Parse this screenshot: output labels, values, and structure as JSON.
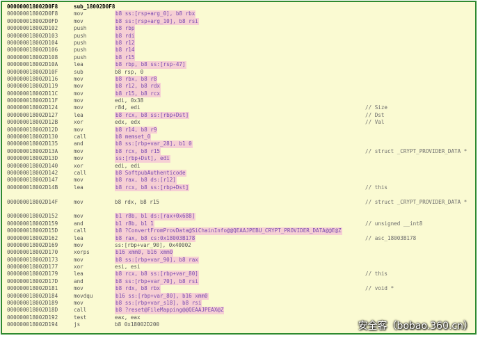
{
  "header": {
    "addr": "000000018002D0F8",
    "name": "sub_18002D0F8"
  },
  "rows": [
    {
      "addr": "000000018002D0F8",
      "mn": "mov",
      "ops": "b8 ss:[rsp+arg_0], b8 rbx",
      "cm": ""
    },
    {
      "addr": "000000018002D0FD",
      "mn": "mov",
      "ops": "b8 ss:[rsp+arg_10], b8 rsi",
      "cm": ""
    },
    {
      "addr": "000000018002D102",
      "mn": "push",
      "ops": "b8 rbp",
      "cm": ""
    },
    {
      "addr": "000000018002D103",
      "mn": "push",
      "ops": "b8 rdi",
      "cm": ""
    },
    {
      "addr": "000000018002D104",
      "mn": "push",
      "ops": "b8 r12",
      "cm": ""
    },
    {
      "addr": "000000018002D106",
      "mn": "push",
      "ops": "b8 r14",
      "cm": ""
    },
    {
      "addr": "000000018002D108",
      "mn": "push",
      "ops": "b8 r15",
      "cm": ""
    },
    {
      "addr": "000000018002D10A",
      "mn": "lea",
      "ops": "b8 rbp, b8 ss:[rsp-47]",
      "cm": ""
    },
    {
      "addr": "000000018002D10F",
      "mn": "sub",
      "ops": "b8 rsp, 0",
      "cm": ""
    },
    {
      "addr": "000000018002D116",
      "mn": "mov",
      "ops": "b8 rbx, b8 r8",
      "cm": ""
    },
    {
      "addr": "000000018002D119",
      "mn": "mov",
      "ops": "b8 r12, b8 rdx",
      "cm": ""
    },
    {
      "addr": "000000018002D11C",
      "mn": "mov",
      "ops": "b8 r15, b8 rcx",
      "cm": ""
    },
    {
      "addr": "000000018002D11F",
      "mn": "mov",
      "ops": "edi, 0x38",
      "cm": ""
    },
    {
      "addr": "000000018002D124",
      "mn": "mov",
      "ops": "r8d, edi",
      "cm": "// Size"
    },
    {
      "addr": "000000018002D127",
      "mn": "lea",
      "ops": "b8 rcx, b8 ss:[rbp+Dst]",
      "cm": "// Dst"
    },
    {
      "addr": "000000018002D12B",
      "mn": "xor",
      "ops": "edx, edx",
      "cm": "// Val"
    },
    {
      "addr": "000000018002D12D",
      "mn": "mov",
      "ops": "b8 r14, b8 r9",
      "cm": ""
    },
    {
      "addr": "000000018002D130",
      "mn": "call",
      "ops": "b8 memset_0",
      "cm": ""
    },
    {
      "addr": "000000018002D135",
      "mn": "and",
      "ops": "b8 ss:[rbp+var_28], b1 0",
      "cm": ""
    },
    {
      "addr": "000000018002D13A",
      "mn": "mov",
      "ops": "b8 rcx, b8 r15",
      "cm": "// struct _CRYPT_PROVIDER_DATA *"
    },
    {
      "addr": "000000018002D13D",
      "mn": "mov",
      "ops": "ss:[rbp+Dst], edi",
      "cm": ""
    },
    {
      "addr": "000000018002D140",
      "mn": "xor",
      "ops": "edi, edi",
      "cm": ""
    },
    {
      "addr": "000000018002D142",
      "mn": "call",
      "ops": "b8 SoftpubAuthenticode",
      "cm": ""
    },
    {
      "addr": "000000018002D147",
      "mn": "mov",
      "ops": "b8 rax, b8 ds:[r12]",
      "cm": ""
    },
    {
      "addr": "000000018002D14B",
      "mn": "lea",
      "ops": "b8 rcx, b8 ss:[rbp+Dst]",
      "cm": "// this"
    },
    {
      "addr": "",
      "mn": "",
      "ops": "",
      "cm": ""
    },
    {
      "addr": "000000018002D14F",
      "mn": "mov",
      "ops": "b8 rdx, b8 r15",
      "cm": "// struct _CRYPT_PROVIDER_DATA *"
    },
    {
      "addr": "",
      "mn": "",
      "ops": "",
      "cm": ""
    },
    {
      "addr": "000000018002D152",
      "mn": "mov",
      "ops": "b1 r8b, b1 ds:[rax+0x688]",
      "cm": ""
    },
    {
      "addr": "000000018002D159",
      "mn": "and",
      "ops": "b1 r8b, b1 1",
      "cm": "// unsigned __int8"
    },
    {
      "addr": "000000018002D15D",
      "mn": "call",
      "ops": "b8 ?ConvertFromProvData@SiChainInfo@@QEAAJPEBU_CRYPT_PROVIDER_DATA@@E@Z",
      "cm": ""
    },
    {
      "addr": "000000018002D162",
      "mn": "lea",
      "ops": "b8 rax, b8 cs:0x18003B178",
      "cm": "// asc_18003B178"
    },
    {
      "addr": "000000018002D169",
      "mn": "mov",
      "ops": "ss:[rbp+var_90], 0x40002",
      "cm": ""
    },
    {
      "addr": "000000018002D170",
      "mn": "xorps",
      "ops": "b16 xmm0, b16 xmm0",
      "cm": ""
    },
    {
      "addr": "000000018002D173",
      "mn": "mov",
      "ops": "b8 ss:[rbp+var_90], b8 rax",
      "cm": ""
    },
    {
      "addr": "000000018002D177",
      "mn": "xor",
      "ops": "esi, esi",
      "cm": ""
    },
    {
      "addr": "000000018002D179",
      "mn": "lea",
      "ops": "b8 rcx, b8 ss:[rbp+var_80]",
      "cm": "// this"
    },
    {
      "addr": "000000018002D17D",
      "mn": "and",
      "ops": "b8 ss:[rbp+var_70], b8 rsi",
      "cm": ""
    },
    {
      "addr": "000000018002D181",
      "mn": "mov",
      "ops": "b8 rdx, b8 rbx",
      "cm": "// void *"
    },
    {
      "addr": "000000018002D184",
      "mn": "movdqu",
      "ops": "b16 ss:[rbp+var_80], b16 xmm0",
      "cm": ""
    },
    {
      "addr": "000000018002D189",
      "mn": "mov",
      "ops": "b8 ss:[rbp+var_s18], b8 rsi",
      "cm": ""
    },
    {
      "addr": "000000018002D18D",
      "mn": "call",
      "ops": "b8 ?reset@FileMapping@@QEAAJPEAX@Z",
      "cm": ""
    },
    {
      "addr": "000000018002D192",
      "mn": "test",
      "ops": "eax, eax",
      "cm": ""
    },
    {
      "addr": "000000018002D194",
      "mn": "js",
      "ops": "b8 0x18002D200",
      "cm": ""
    }
  ],
  "watermark": "安全客（bobao.360.cn）"
}
